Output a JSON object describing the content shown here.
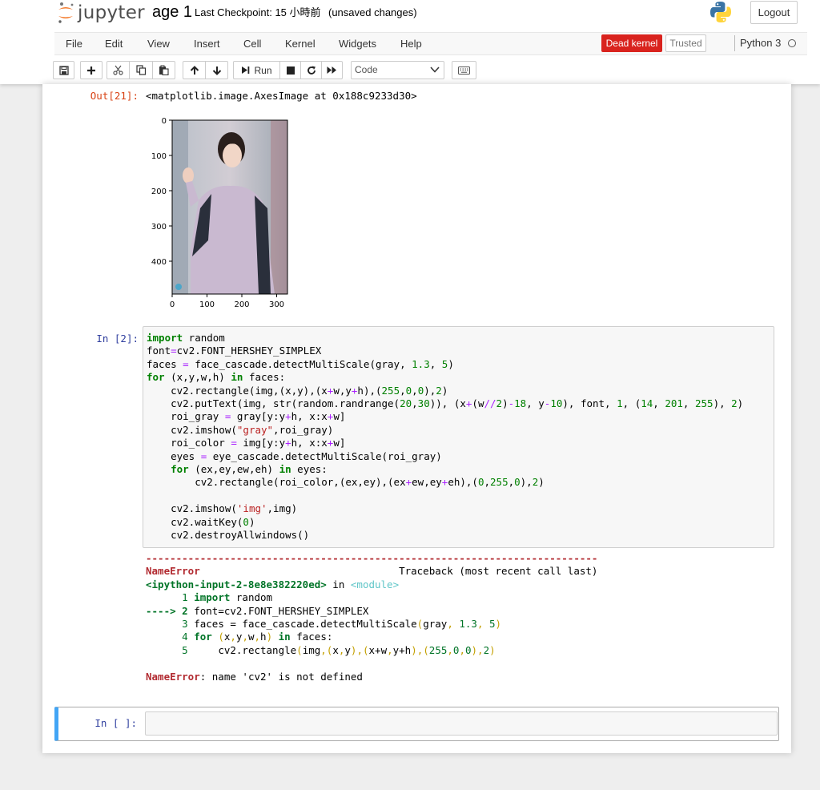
{
  "header": {
    "logo_text": "jupyter",
    "notebook_name": "age 1",
    "checkpoint": "Last Checkpoint: 15 小時前",
    "autosave_status": "(unsaved changes)",
    "logout_label": "Logout"
  },
  "menu": {
    "items": [
      "File",
      "Edit",
      "View",
      "Insert",
      "Cell",
      "Kernel",
      "Widgets",
      "Help"
    ]
  },
  "kernel": {
    "status": "Dead kernel",
    "trusted": "Trusted",
    "name": "Python 3"
  },
  "toolbar": {
    "run_label": "Run",
    "cell_type": "Code",
    "icons": [
      "save-icon",
      "plus-icon",
      "cut-icon",
      "copy-icon",
      "paste-icon",
      "arrow-up-icon",
      "arrow-down-icon",
      "step-forward-icon",
      "stop-icon",
      "restart-icon",
      "fast-forward-icon",
      "chevron-down-icon",
      "keyboard-icon"
    ]
  },
  "cells": {
    "output_prompt": "Out[21]:",
    "output_text": "<matplotlib.image.AxesImage at 0x188c9233d30>",
    "plot": {
      "y_ticks": [
        "0",
        "100",
        "200",
        "300",
        "400"
      ],
      "x_ticks": [
        "0",
        "100",
        "200",
        "300"
      ]
    },
    "input_prompt": "In [2]:",
    "code_lines": [
      "import random",
      "font=cv2.FONT_HERSHEY_SIMPLEX",
      "faces = face_cascade.detectMultiScale(gray, 1.3, 5)",
      "for (x,y,w,h) in faces:",
      "    cv2.rectangle(img,(x,y),(x+w,y+h),(255,0,0),2)",
      "    cv2.putText(img, str(random.randrange(20,30)), (x+(w//2)-18, y-10), font, 1, (14, 201, 255), 2)",
      "    roi_gray = gray[y:y+h, x:x+w]",
      "    cv2.imshow(\"gray\",roi_gray)",
      "    roi_color = img[y:y+h, x:x+w]",
      "    eyes = eye_cascade.detectMultiScale(roi_gray)",
      "    for (ex,ey,ew,eh) in eyes:",
      "        cv2.rectangle(roi_color,(ex,ey),(ex+ew,ey+eh),(0,255,0),2)",
      "",
      "    cv2.imshow('img',img)",
      "    cv2.waitKey(0)",
      "    cv2.destroyAllwindows()"
    ],
    "error": {
      "separator": "---------------------------------------------------------------------------",
      "name": "NameError",
      "traceback_header": "Traceback (most recent call last)",
      "location_file": "<ipython-input-2-8e8e382220ed>",
      "location_in": " in ",
      "location_module": "<module>",
      "trace_lines": [
        {
          "marker": "      1",
          "code": "import random"
        },
        {
          "marker": "----> 2",
          "code": "font=cv2.FONT_HERSHEY_SIMPLEX"
        },
        {
          "marker": "      3",
          "code": "faces = face_cascade.detectMultiScale(gray, 1.3, 5)"
        },
        {
          "marker": "      4",
          "code": "for (x,y,w,h) in faces:"
        },
        {
          "marker": "      5",
          "code": "    cv2.rectangle(img,(x,y),(x+w,y+h),(255,0,0),2)"
        }
      ],
      "message_name": "NameError",
      "message": ": name 'cv2' is not defined"
    },
    "empty_prompt": "In [ ]:"
  },
  "colors": {
    "dead_kernel": "#d9231e",
    "input_prompt": "#303f9f",
    "output_prompt": "#d84315",
    "selected_cell": "#42a5f5"
  }
}
